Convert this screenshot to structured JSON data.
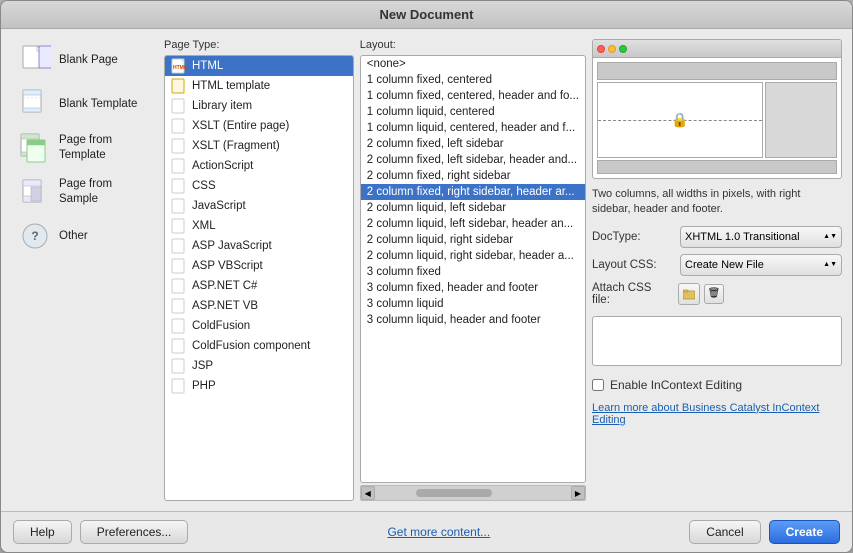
{
  "dialog": {
    "title": "New Document"
  },
  "left_sidebar": {
    "items": [
      {
        "id": "blank-page",
        "label": "Blank Page"
      },
      {
        "id": "blank-template",
        "label": "Blank Template"
      },
      {
        "id": "page-from-template",
        "label": "Page from Template"
      },
      {
        "id": "page-from-sample",
        "label": "Page from Sample"
      },
      {
        "id": "other",
        "label": "Other"
      }
    ]
  },
  "page_type": {
    "label": "Page Type:",
    "items": [
      {
        "id": "html",
        "label": "HTML",
        "selected": true
      },
      {
        "id": "html-template",
        "label": "HTML template"
      },
      {
        "id": "library-item",
        "label": "Library item"
      },
      {
        "id": "xslt-entire",
        "label": "XSLT (Entire page)"
      },
      {
        "id": "xslt-fragment",
        "label": "XSLT (Fragment)"
      },
      {
        "id": "actionscript",
        "label": "ActionScript"
      },
      {
        "id": "css",
        "label": "CSS"
      },
      {
        "id": "javascript",
        "label": "JavaScript"
      },
      {
        "id": "xml",
        "label": "XML"
      },
      {
        "id": "asp-javascript",
        "label": "ASP JavaScript"
      },
      {
        "id": "asp-vbscript",
        "label": "ASP VBScript"
      },
      {
        "id": "aspnet-csharp",
        "label": "ASP.NET C#"
      },
      {
        "id": "aspnet-vb",
        "label": "ASP.NET VB"
      },
      {
        "id": "coldfusion",
        "label": "ColdFusion"
      },
      {
        "id": "coldfusion-component",
        "label": "ColdFusion component"
      },
      {
        "id": "jsp",
        "label": "JSP"
      },
      {
        "id": "php",
        "label": "PHP"
      }
    ]
  },
  "layout": {
    "label": "Layout:",
    "items": [
      {
        "id": "none",
        "label": "<none>"
      },
      {
        "id": "1col-fixed-centered",
        "label": "1 column fixed, centered"
      },
      {
        "id": "1col-fixed-centered-hf",
        "label": "1 column fixed, centered, header and fo..."
      },
      {
        "id": "1col-liquid-centered",
        "label": "1 column liquid, centered"
      },
      {
        "id": "1col-liquid-centered-hf",
        "label": "1 column liquid, centered, header and f..."
      },
      {
        "id": "2col-fixed-left-sidebar",
        "label": "2 column fixed, left sidebar"
      },
      {
        "id": "2col-fixed-left-sidebar-and",
        "label": "2 column fixed, left sidebar, header and..."
      },
      {
        "id": "2col-fixed-right-sidebar",
        "label": "2 column fixed, right sidebar"
      },
      {
        "id": "2col-fixed-right-sidebar-haf",
        "label": "2 column fixed, right sidebar, header ar...",
        "selected": true
      },
      {
        "id": "2col-liquid-left-sidebar",
        "label": "2 column liquid, left sidebar"
      },
      {
        "id": "2col-liquid-left-sidebar-ha",
        "label": "2 column liquid, left sidebar, header an..."
      },
      {
        "id": "2col-liquid-right-sidebar",
        "label": "2 column liquid, right sidebar"
      },
      {
        "id": "2col-liquid-right-sidebar-ha",
        "label": "2 column liquid, right sidebar, header a..."
      },
      {
        "id": "3col-fixed",
        "label": "3 column fixed"
      },
      {
        "id": "3col-fixed-hf",
        "label": "3 column fixed, header and footer"
      },
      {
        "id": "3col-liquid",
        "label": "3 column liquid"
      },
      {
        "id": "3col-liquid-hf",
        "label": "3 column liquid, header and footer"
      }
    ]
  },
  "preview": {
    "description": "Two columns, all widths in pixels, with right sidebar, header and footer."
  },
  "doctype": {
    "label": "DocType:",
    "value": "XHTML 1.0 Transitional"
  },
  "layout_css": {
    "label": "Layout CSS:",
    "value": "Create New File"
  },
  "attach_css": {
    "label": "Attach CSS file:"
  },
  "enable_incontext": {
    "label": "Enable InContext Editing"
  },
  "learn_more": {
    "text": "Learn more about Business Catalyst InContext Editing"
  },
  "bottom_bar": {
    "help_label": "Help",
    "preferences_label": "Preferences...",
    "get_more_label": "Get more content...",
    "cancel_label": "Cancel",
    "create_label": "Create"
  }
}
